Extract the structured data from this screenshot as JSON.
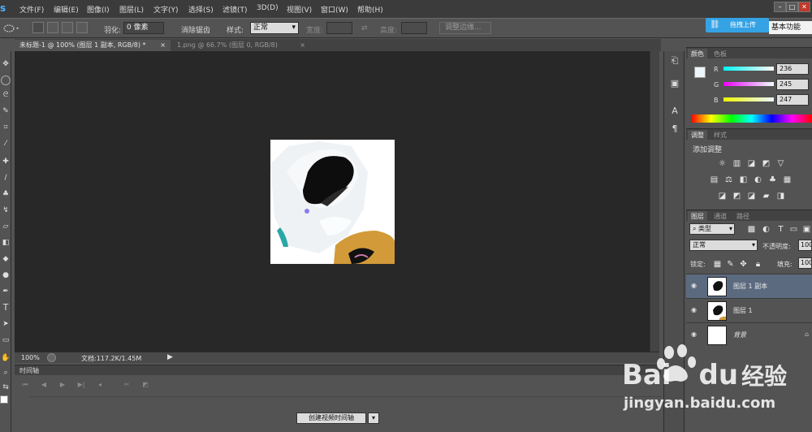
{
  "app": {
    "logo": "s"
  },
  "menu": [
    "文件(F)",
    "编辑(E)",
    "图像(I)",
    "图层(L)",
    "文字(Y)",
    "选择(S)",
    "滤镜(T)",
    "3D(D)",
    "视图(V)",
    "窗口(W)",
    "帮助(H)"
  ],
  "window_controls": {
    "minimize": "–",
    "restore": "□",
    "close": "✕"
  },
  "options": {
    "feather_label": "羽化:",
    "feather_value": "0 像素",
    "antialias_label": "消除锯齿",
    "style_label": "样式:",
    "style_value": "正常",
    "width_label": "宽度:",
    "height_label": "高度:",
    "refine_edge": "调整边缘...",
    "upload_label": "拖拽上传",
    "workspace_label": "基本功能"
  },
  "tabs": [
    {
      "label": "未标题-1 @ 100% (图层 1 副本, RGB/8) *",
      "close": "×",
      "active": true
    },
    {
      "label": "1.png @ 66.7% (图层 0, RGB/8)",
      "close": "×",
      "active": false
    }
  ],
  "status": {
    "zoom": "100%",
    "doc_info": "文档:117.2K/1.45M"
  },
  "timeline": {
    "header": "时间轴",
    "create_button": "创建视频时间轴"
  },
  "color_panel": {
    "tabs": [
      "颜色",
      "色板"
    ],
    "r_label": "R",
    "r_value": "236",
    "g_label": "G",
    "g_value": "245",
    "b_label": "B",
    "b_value": "247",
    "foreground_color": "#ecf5f7"
  },
  "adjust_panel": {
    "tabs": [
      "调整",
      "样式"
    ],
    "title": "添加调整"
  },
  "layers_panel": {
    "tabs": [
      "图层",
      "通道",
      "路径"
    ],
    "kind_label": "类型",
    "blend_mode": "正常",
    "opacity_label": "不透明度:",
    "opacity_value": "100",
    "lock_label": "锁定:",
    "fill_label": "填充:",
    "fill_value": "100",
    "layers": [
      {
        "name": "图层 1 副本",
        "selected": true
      },
      {
        "name": "图层 1",
        "selected": false
      },
      {
        "name": "背景",
        "selected": false
      }
    ]
  },
  "watermark": {
    "brand": "Bai",
    "brand_suffix": "du",
    "brand_cn": "经验",
    "url": "jingyan.baidu.com"
  }
}
